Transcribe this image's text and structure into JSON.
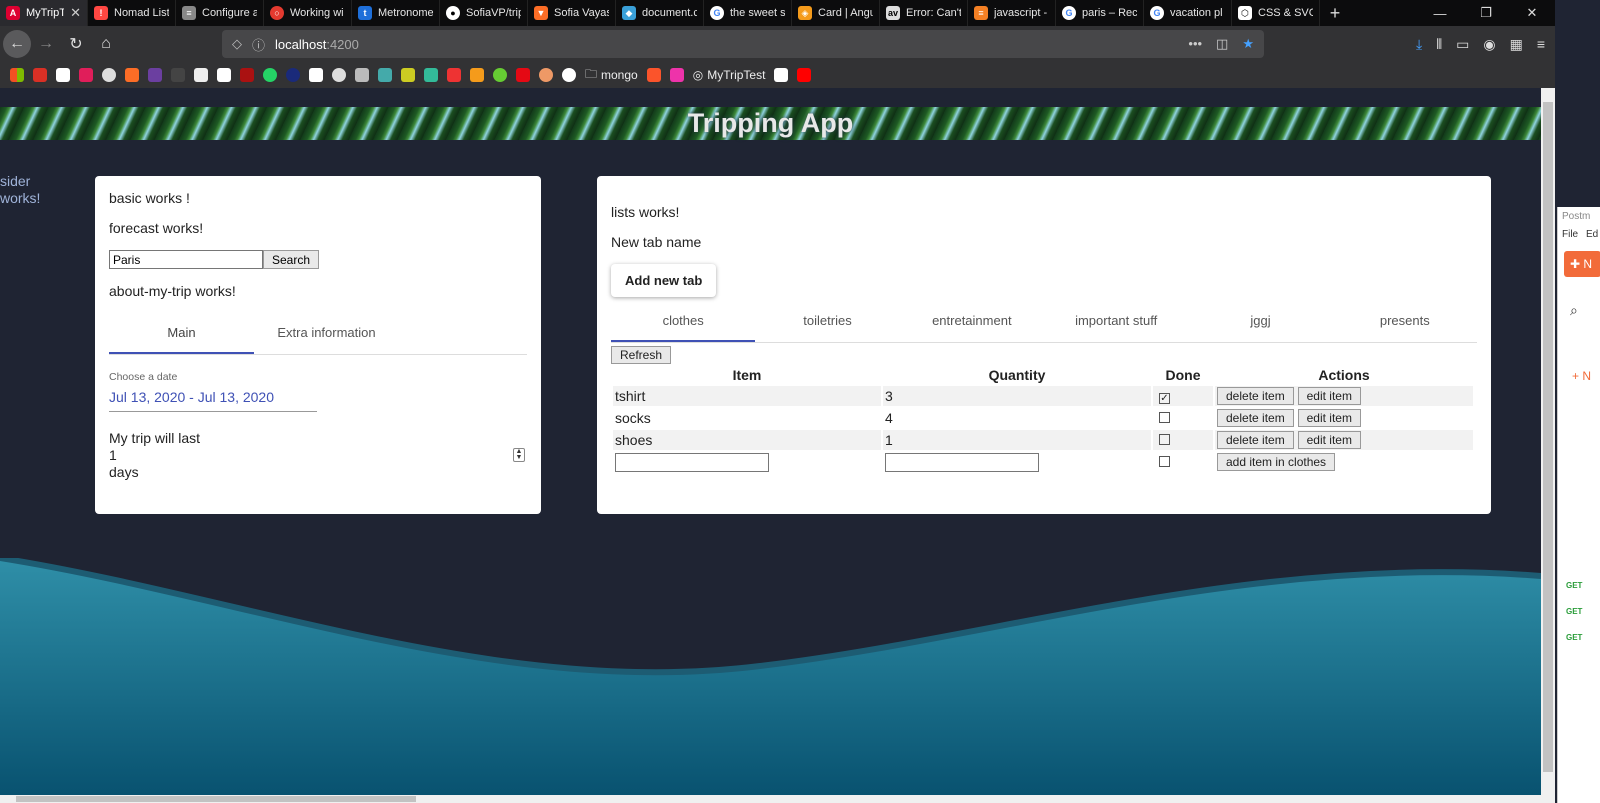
{
  "browser": {
    "tabs": [
      {
        "title": "MyTripT",
        "icon": "angular-icon",
        "color": "#dd0031",
        "active": true
      },
      {
        "title": "Nomad List",
        "icon": "nomad-icon",
        "color": "#ff4742"
      },
      {
        "title": "Configure a",
        "icon": "doc-icon",
        "color": "#888888"
      },
      {
        "title": "Working wi",
        "icon": "circle-icon",
        "color": "#e43a2f"
      },
      {
        "title": "Metronome",
        "icon": "t-icon",
        "color": "#1e6fd9"
      },
      {
        "title": "SofiaVP/trip",
        "icon": "github-icon",
        "color": "#ffffff"
      },
      {
        "title": "Sofia Vayas",
        "icon": "gitlab-icon",
        "color": "#fc6d26"
      },
      {
        "title": "document.c",
        "icon": "bird-icon",
        "color": "#3aa0d8"
      },
      {
        "title": "the sweet s",
        "icon": "google-icon",
        "color": "#4285f4"
      },
      {
        "title": "Card | Angu",
        "icon": "shield-icon",
        "color": "#f59b1b"
      },
      {
        "title": "Error: Can't",
        "icon": "av-icon",
        "color": "#dddddd"
      },
      {
        "title": "javascript -",
        "icon": "stack-icon",
        "color": "#f48024"
      },
      {
        "title": "paris – Rec",
        "icon": "google-icon",
        "color": "#4285f4"
      },
      {
        "title": "vacation pl",
        "icon": "google-icon",
        "color": "#4285f4"
      },
      {
        "title": "CSS & SVG",
        "icon": "codepen-icon",
        "color": "#ffffff"
      }
    ],
    "url_host": "localhost",
    "url_port": ":4200",
    "bookmarks_folder_1": "mongo",
    "bookmarks_folder_2": "MyTripTest"
  },
  "app": {
    "title": "Tripping App",
    "sider_line1": "sider",
    "sider_line2": "works!"
  },
  "left_card": {
    "basic": "basic works !",
    "forecast": "forecast works!",
    "search_value": "Paris",
    "search_button": "Search",
    "about": "about-my-trip works!",
    "tabs": [
      "Main",
      "Extra information"
    ],
    "date_label": "Choose a date",
    "date_value": "Jul 13, 2020 - Jul 13, 2020",
    "trip_line1": "My trip will last",
    "trip_days": "1",
    "trip_line3": "days"
  },
  "right_card": {
    "lists": "lists works!",
    "new_tab_name": "New tab name",
    "add_tab_button": "Add new tab",
    "tabs": [
      "clothes",
      "toiletries",
      "entretainment",
      "important stuff",
      "jggj",
      "presents"
    ],
    "refresh": "Refresh",
    "columns": [
      "Item",
      "Quantity",
      "Done",
      "Actions"
    ],
    "rows": [
      {
        "item": "tshirt",
        "quantity": "3",
        "done": true
      },
      {
        "item": "socks",
        "quantity": "4",
        "done": false
      },
      {
        "item": "shoes",
        "quantity": "1",
        "done": false
      }
    ],
    "delete_label": "delete item",
    "edit_label": "edit item",
    "add_label": "add item in clothes"
  },
  "side_window": {
    "title": "Postm",
    "menu_file": "File",
    "menu_edit": "Ed",
    "new_label": "N",
    "get_label": "GET"
  }
}
